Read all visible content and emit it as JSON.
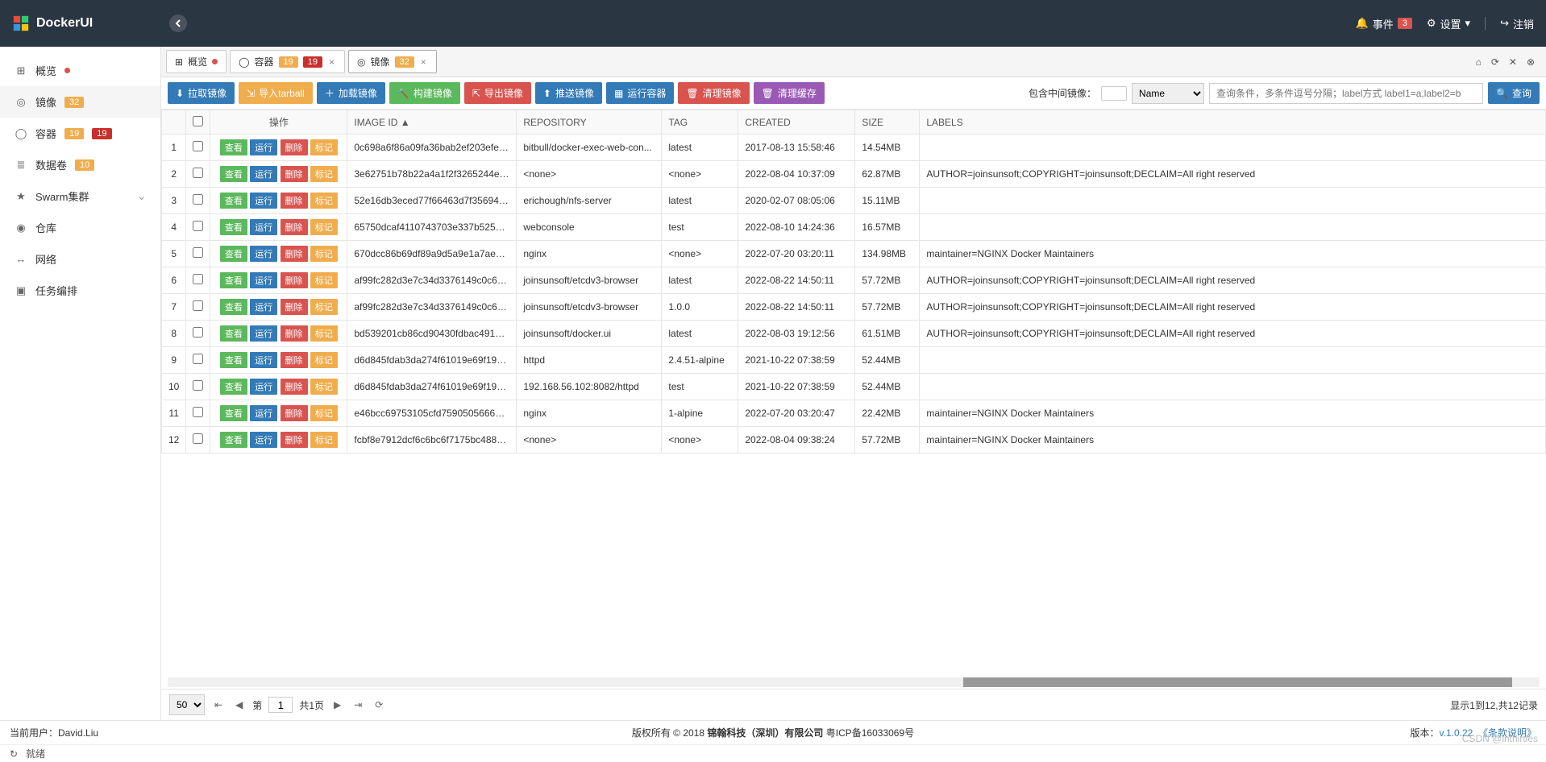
{
  "app": {
    "title": "DockerUI"
  },
  "header": {
    "events_label": "事件",
    "events_count": "3",
    "settings_label": "设置",
    "logout_label": "注销"
  },
  "sidebar": {
    "items": [
      {
        "label": "概览",
        "icon": "⊞",
        "dot": true
      },
      {
        "label": "镜像",
        "icon": "◎",
        "badge1": "32",
        "active": true
      },
      {
        "label": "容器",
        "icon": "◯",
        "badge1": "19",
        "badge2": "19"
      },
      {
        "label": "数据卷",
        "icon": "≣",
        "badge1": "10"
      },
      {
        "label": "Swarm集群",
        "icon": "★",
        "expand": true
      },
      {
        "label": "仓库",
        "icon": "◉"
      },
      {
        "label": "网络",
        "icon": "↔"
      },
      {
        "label": "任务编排",
        "icon": "▣"
      }
    ]
  },
  "tabs": [
    {
      "label": "概览",
      "icon": "⊞",
      "dot": true
    },
    {
      "label": "容器",
      "icon": "◯",
      "badge1": "19",
      "badge2": "19",
      "closable": true
    },
    {
      "label": "镜像",
      "icon": "◎",
      "badge1": "32",
      "closable": true,
      "active": true
    }
  ],
  "toolbar": {
    "pull": "拉取镜像",
    "import_tarball": "导入tarball",
    "load": "加载镜像",
    "build": "构建镜像",
    "export": "导出镜像",
    "push": "推送镜像",
    "run_container": "运行容器",
    "clean_image": "清理镜像",
    "clean_cache": "清理缓存",
    "include_mid_label": "包含中间镜像：",
    "filter_label": "Name",
    "search_placeholder": "查询条件，多条件逗号分隔；label方式 label1=a,label2=b",
    "search_btn": "查询"
  },
  "table": {
    "headers": {
      "ops": "操作",
      "image_id": "IMAGE ID ▲",
      "repository": "REPOSITORY",
      "tag": "TAG",
      "created": "CREATED",
      "size": "SIZE",
      "labels": "LABELS"
    },
    "op_labels": {
      "view": "查看",
      "run": "运行",
      "del": "删除",
      "tag": "标记"
    },
    "rows": [
      {
        "n": "1",
        "id": "0c698a6f86a09fa36bab2ef203efe2f...",
        "repo": "bitbull/docker-exec-web-con...",
        "tag": "latest",
        "created": "2017-08-13 15:58:46",
        "size": "14.54MB",
        "labels": ""
      },
      {
        "n": "2",
        "id": "3e62751b78b22a4a1f2f3265244ef6...",
        "repo": "<none>",
        "tag": "<none>",
        "created": "2022-08-04 10:37:09",
        "size": "62.87MB",
        "labels": "AUTHOR=joinsunsoft;COPYRIGHT=joinsunsoft;DECLAIM=All right reserved"
      },
      {
        "n": "3",
        "id": "52e16db3eced77f66463d7f356946...",
        "repo": "erichough/nfs-server",
        "tag": "latest",
        "created": "2020-02-07 08:05:06",
        "size": "15.11MB",
        "labels": ""
      },
      {
        "n": "4",
        "id": "65750dcaf4110743703e337b5258e...",
        "repo": "webconsole",
        "tag": "test",
        "created": "2022-08-10 14:24:36",
        "size": "16.57MB",
        "labels": ""
      },
      {
        "n": "5",
        "id": "670dcc86b69df89a9d5a9e1a7ae5b...",
        "repo": "nginx",
        "tag": "<none>",
        "created": "2022-07-20 03:20:11",
        "size": "134.98MB",
        "labels": "maintainer=NGINX Docker Maintainers"
      },
      {
        "n": "6",
        "id": "af99fc282d3e7c34d3376149c0c6ef...",
        "repo": "joinsunsoft/etcdv3-browser",
        "tag": "latest",
        "created": "2022-08-22 14:50:11",
        "size": "57.72MB",
        "labels": "AUTHOR=joinsunsoft;COPYRIGHT=joinsunsoft;DECLAIM=All right reserved"
      },
      {
        "n": "7",
        "id": "af99fc282d3e7c34d3376149c0c6ef...",
        "repo": "joinsunsoft/etcdv3-browser",
        "tag": "1.0.0",
        "created": "2022-08-22 14:50:11",
        "size": "57.72MB",
        "labels": "AUTHOR=joinsunsoft;COPYRIGHT=joinsunsoft;DECLAIM=All right reserved"
      },
      {
        "n": "8",
        "id": "bd539201cb86cd90430fdbac4917d...",
        "repo": "joinsunsoft/docker.ui",
        "tag": "latest",
        "created": "2022-08-03 19:12:56",
        "size": "61.51MB",
        "labels": "AUTHOR=joinsunsoft;COPYRIGHT=joinsunsoft;DECLAIM=All right reserved"
      },
      {
        "n": "9",
        "id": "d6d845fdab3da274f61019e69f19e...",
        "repo": "httpd",
        "tag": "2.4.51-alpine",
        "created": "2021-10-22 07:38:59",
        "size": "52.44MB",
        "labels": ""
      },
      {
        "n": "10",
        "id": "d6d845fdab3da274f61019e69f19e...",
        "repo": "192.168.56.102:8082/httpd",
        "tag": "test",
        "created": "2021-10-22 07:38:59",
        "size": "52.44MB",
        "labels": ""
      },
      {
        "n": "11",
        "id": "e46bcc69753105cfd75905056666b...",
        "repo": "nginx",
        "tag": "1-alpine",
        "created": "2022-07-20 03:20:47",
        "size": "22.42MB",
        "labels": "maintainer=NGINX Docker Maintainers"
      },
      {
        "n": "12",
        "id": "fcbf8e7912dcf6c6bc6f7175bc4884...",
        "repo": "<none>",
        "tag": "<none>",
        "created": "2022-08-04 09:38:24",
        "size": "57.72MB",
        "labels": "maintainer=NGINX Docker Maintainers"
      }
    ]
  },
  "pager": {
    "page_size": "50",
    "page_label_prefix": "第",
    "page_value": "1",
    "total_pages_label": "共1页",
    "summary": "显示1到12,共12记录"
  },
  "footer": {
    "current_user_label": "当前用户：",
    "current_user": "David.Liu",
    "copyright_prefix": "版权所有 © 2018 ",
    "company": "锦翰科技（深圳）有限公司",
    "icp": " 粤ICP备16033069号",
    "version_label": "版本：",
    "version_link": "v.1.0.22",
    "terms": "《条款说明》"
  },
  "status": {
    "ready": "就绪"
  },
  "watermark": "CSDN @inthirties"
}
